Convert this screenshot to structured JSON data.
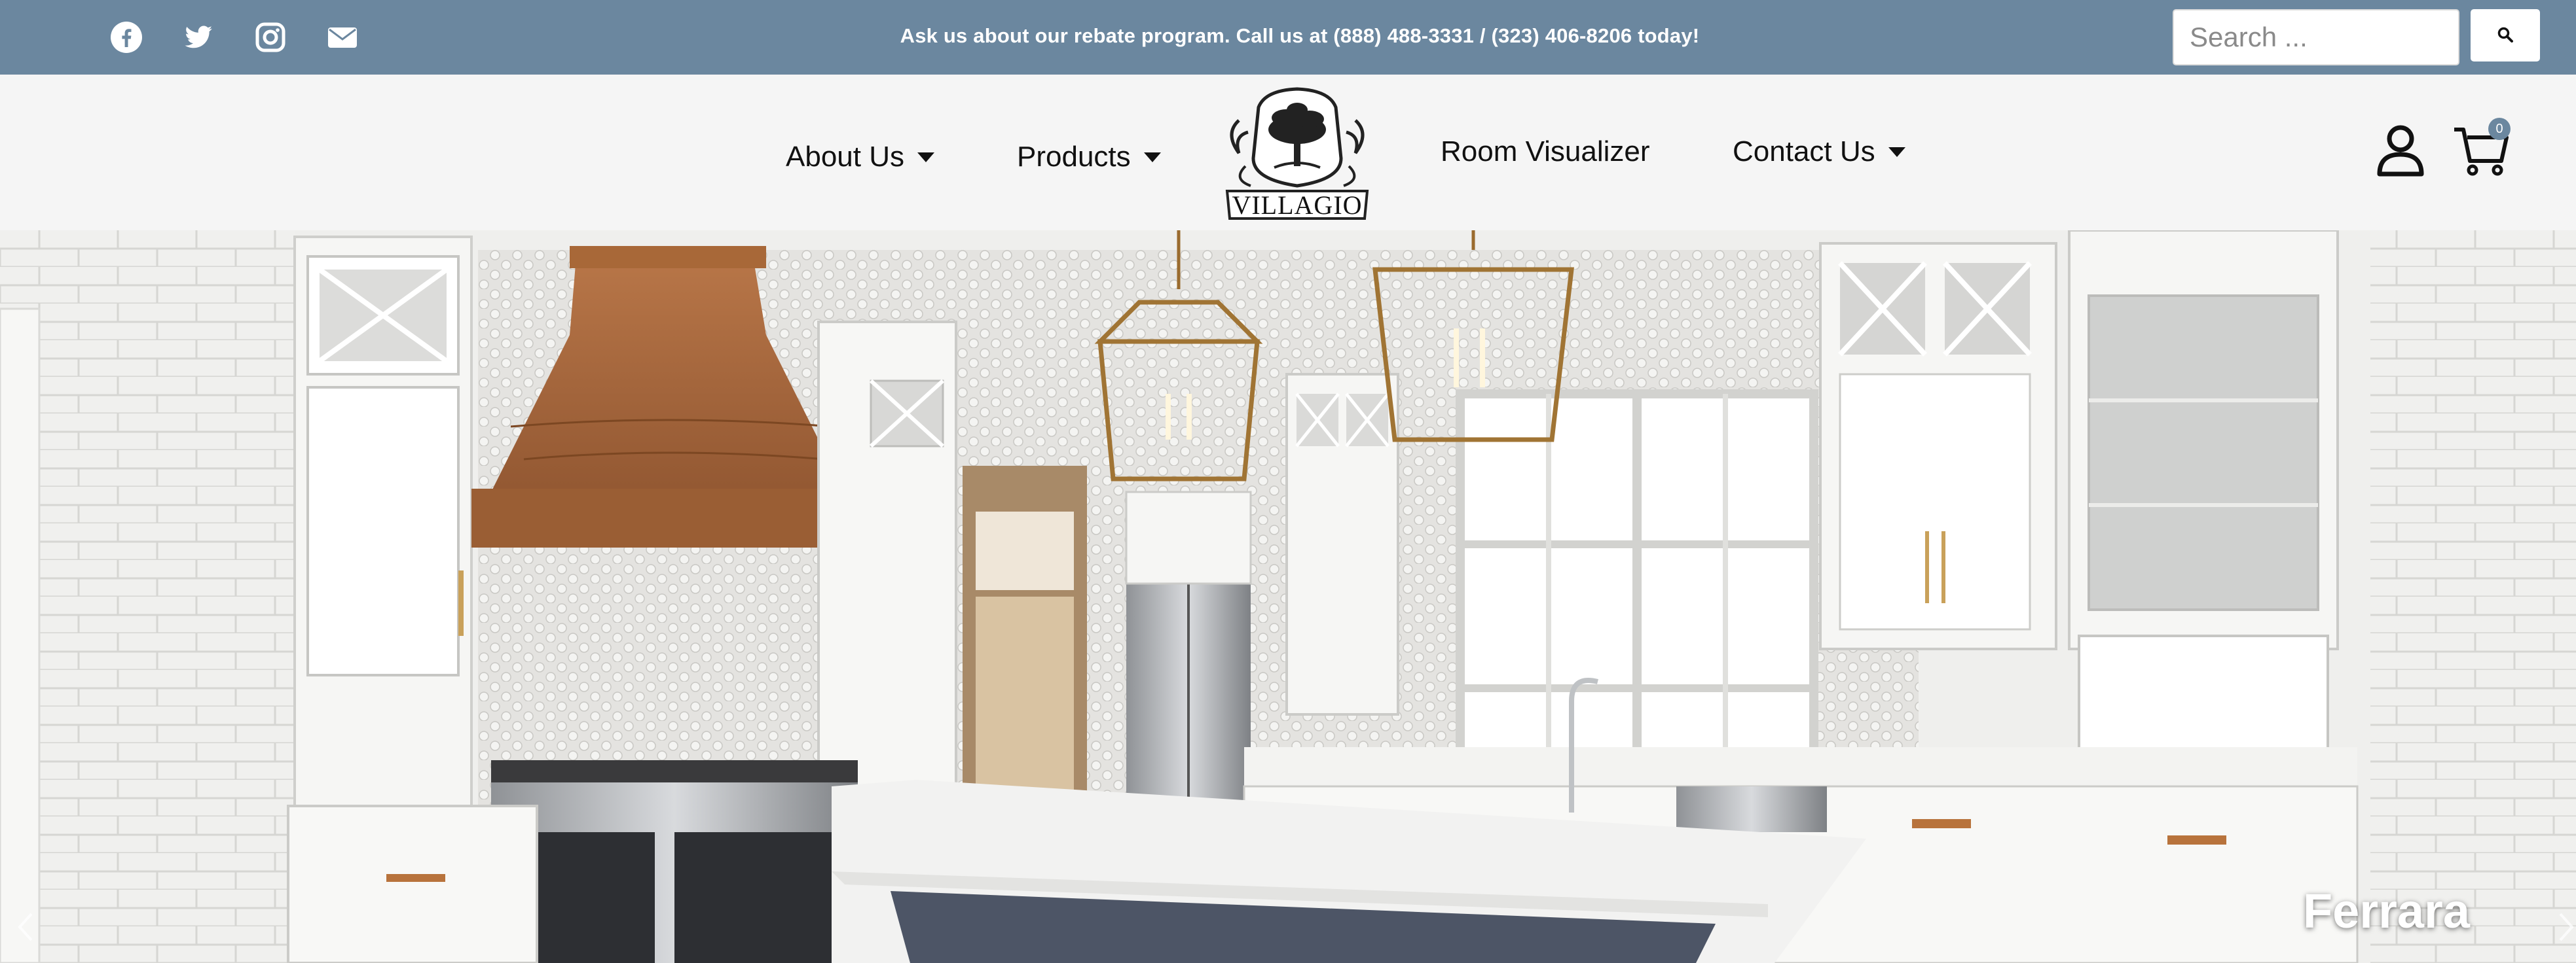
{
  "topbar": {
    "social": [
      "facebook-icon",
      "twitter-icon",
      "instagram-icon",
      "envelope-icon"
    ],
    "announcement": "Ask us about our rebate program. Call us at (888) 488-3331 / (323) 406-8206 today!",
    "search_placeholder": "Search ...",
    "search_button_icon": "search-icon",
    "background": "#6b879f"
  },
  "nav": {
    "items": [
      {
        "label": "About Us",
        "has_dropdown": true
      },
      {
        "label": "Products",
        "has_dropdown": true
      },
      {
        "label": "Room Visualizer",
        "has_dropdown": false
      },
      {
        "label": "Contact Us",
        "has_dropdown": true
      }
    ],
    "logo_text": "VILLAGIO",
    "account_icon": "user-icon",
    "cart_icon": "cart-icon",
    "cart_count": "0"
  },
  "hero": {
    "caption": "Ferrara",
    "prev_icon": "chevron-left-icon",
    "next_icon": "chevron-right-icon"
  },
  "colors": {
    "accent": "#6b879f",
    "nav_bg": "#f5f5f5",
    "text": "#111111"
  }
}
